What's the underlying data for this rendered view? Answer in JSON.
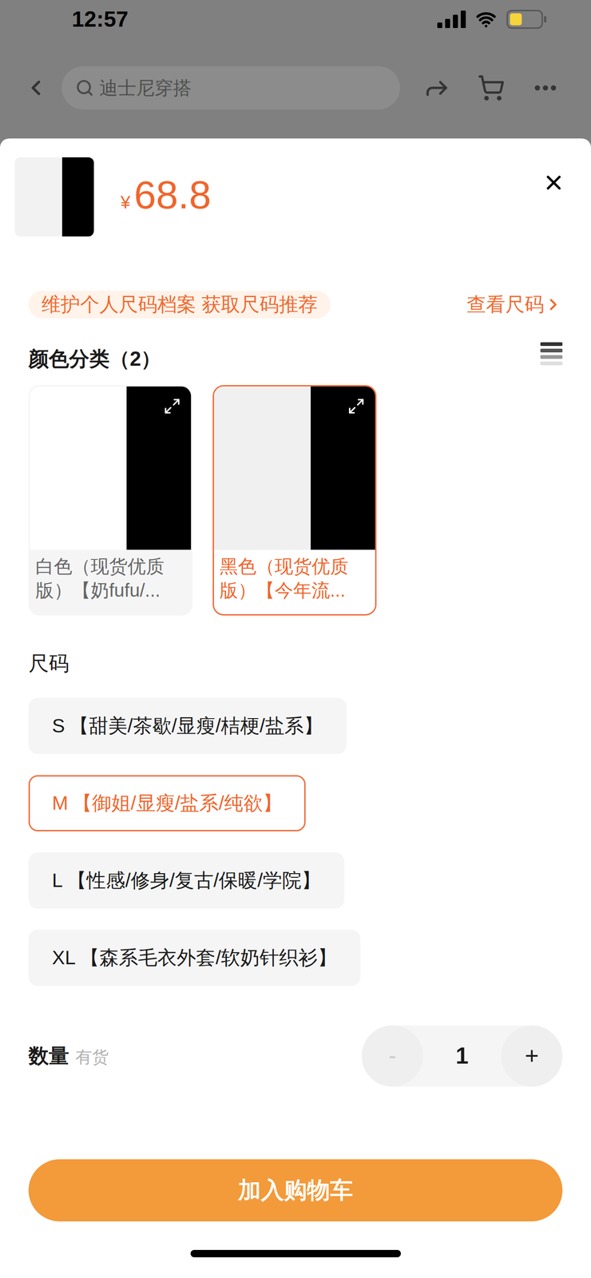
{
  "status_bar": {
    "time": "12:57",
    "battery_level": 0.4
  },
  "nav": {
    "search_placeholder": "迪士尼穿搭"
  },
  "sheet": {
    "price_symbol": "¥",
    "price": "68.8",
    "size_profile": {
      "prompt": "维护个人尺码档案 获取尺码推荐",
      "link": "查看尺码"
    },
    "color_section": {
      "title": "颜色分类（2）",
      "options": [
        {
          "label": "白色（现货优质版）【奶fufu/...",
          "selected": false
        },
        {
          "label": "黑色（现货优质版）【今年流...",
          "selected": true
        }
      ]
    },
    "size_section": {
      "title": "尺码",
      "options": [
        {
          "size": "S",
          "tags": "【甜美/茶歇/显瘦/桔梗/盐系】",
          "selected": false
        },
        {
          "size": "M",
          "tags": "【御姐/显瘦/盐系/纯欲】",
          "selected": true
        },
        {
          "size": "L",
          "tags": "【性感/修身/复古/保暖/学院】",
          "selected": false
        },
        {
          "size": "XL",
          "tags": "【森系毛衣外套/软奶针织衫】",
          "selected": false
        }
      ]
    },
    "quantity": {
      "label": "数量",
      "stock": "有货",
      "value": "1",
      "decrement": "-",
      "increment": "+",
      "decrement_disabled": true
    },
    "add_to_cart": "加入购物车"
  }
}
